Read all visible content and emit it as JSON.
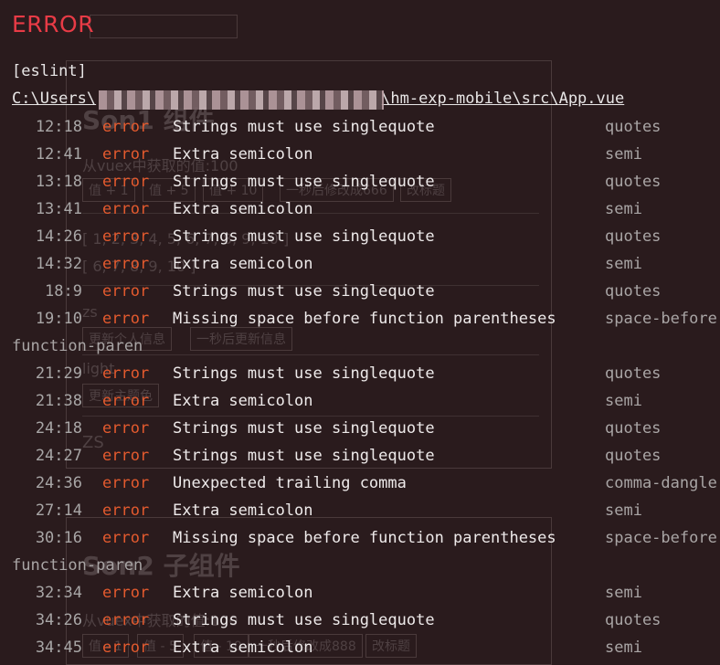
{
  "overlay": {
    "title": "ERROR",
    "source": "[eslint]",
    "file_path_visible_start": "C:\\Users\\",
    "file_path_visible_end": "\\hm-exp-mobile\\src\\App.vue",
    "messages": [
      {
        "loc": "12:18",
        "severity": "error",
        "message": "Strings must use singlequote",
        "rule": "quotes"
      },
      {
        "loc": "12:41",
        "severity": "error",
        "message": "Extra semicolon",
        "rule": "semi"
      },
      {
        "loc": "13:18",
        "severity": "error",
        "message": "Strings must use singlequote",
        "rule": "quotes"
      },
      {
        "loc": "13:41",
        "severity": "error",
        "message": "Extra semicolon",
        "rule": "semi"
      },
      {
        "loc": "14:26",
        "severity": "error",
        "message": "Strings must use singlequote",
        "rule": "quotes"
      },
      {
        "loc": "14:32",
        "severity": "error",
        "message": "Extra semicolon",
        "rule": "semi"
      },
      {
        "loc": "18:9",
        "severity": "error",
        "message": "Strings must use singlequote",
        "rule": "quotes"
      },
      {
        "loc": "19:10",
        "severity": "error",
        "message": "Missing space before function parentheses",
        "rule": "space-before",
        "rule_continued": "function-paren"
      },
      {
        "loc": "21:29",
        "severity": "error",
        "message": "Strings must use singlequote",
        "rule": "quotes"
      },
      {
        "loc": "21:38",
        "severity": "error",
        "message": "Extra semicolon",
        "rule": "semi"
      },
      {
        "loc": "24:18",
        "severity": "error",
        "message": "Strings must use singlequote",
        "rule": "quotes"
      },
      {
        "loc": "24:27",
        "severity": "error",
        "message": "Strings must use singlequote",
        "rule": "quotes"
      },
      {
        "loc": "24:36",
        "severity": "error",
        "message": "Unexpected trailing comma",
        "rule": "comma-dangle"
      },
      {
        "loc": "27:14",
        "severity": "error",
        "message": "Extra semicolon",
        "rule": "semi"
      },
      {
        "loc": "30:16",
        "severity": "error",
        "message": "Missing space before function parentheses",
        "rule": "space-before",
        "rule_continued": "function-paren"
      },
      {
        "loc": "32:34",
        "severity": "error",
        "message": "Extra semicolon",
        "rule": "semi"
      },
      {
        "loc": "34:26",
        "severity": "error",
        "message": "Strings must use singlequote",
        "rule": "quotes"
      },
      {
        "loc": "34:45",
        "severity": "error",
        "message": "Extra semicolon",
        "rule": "semi"
      }
    ]
  },
  "background_app": {
    "heading_top": "Son1 组件",
    "vuex_value_text": "从vuex中获取的值:100",
    "buttons_row1": [
      "值 + 1",
      "值 + 5",
      "值 + 10",
      "一秒后修改成666",
      "改标题"
    ],
    "array_text_1": "[ 1, 2, 3, 4, 5, 6, 7, 8, 9, 10 ]",
    "array_text_2": "[ 6, 7, 8, 9, 10 ]",
    "name_text_1": "zs",
    "buttons_row2": [
      "更新个人信息",
      "一秒后更新信息"
    ],
    "theme_text": "light",
    "theme_button": "更新主题色",
    "name_text_2": "ZS",
    "heading_bottom": "Son2 子组件",
    "vuex_value_text_bottom": "从vuex中获取的值:100",
    "buttons_row3": [
      "值 - 1",
      "值 - 5",
      "值 - 10",
      "一秒后修改成888",
      "改标题"
    ]
  },
  "colors": {
    "background": "#2a1b1d",
    "title_red": "#e83b46",
    "severity_orange": "#e35a2e",
    "message_text": "#eeeaea",
    "dim_text": "#a8a6a6"
  }
}
